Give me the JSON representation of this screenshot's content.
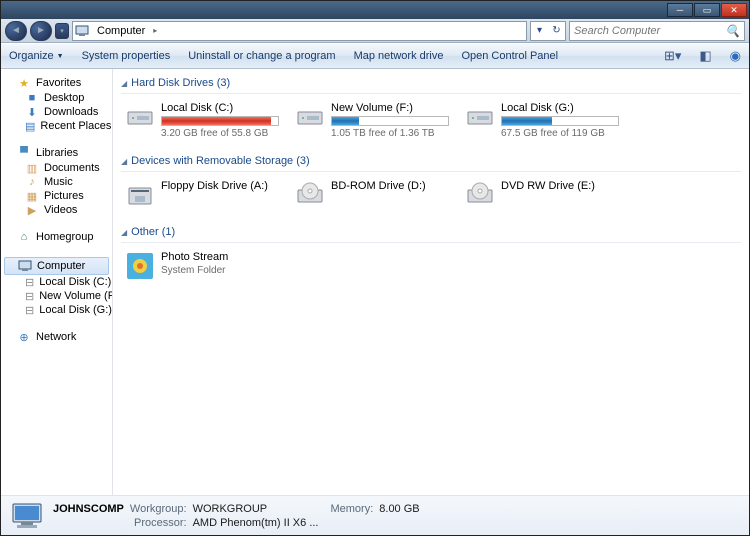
{
  "breadcrumb": {
    "location": "Computer"
  },
  "search": {
    "placeholder": "Search Computer"
  },
  "toolbar": {
    "organize": "Organize",
    "sysprops": "System properties",
    "uninstall": "Uninstall or change a program",
    "mapdrive": "Map network drive",
    "controlpanel": "Open Control Panel"
  },
  "sidebar": {
    "favorites": {
      "label": "Favorites",
      "items": [
        "Desktop",
        "Downloads",
        "Recent Places"
      ]
    },
    "libraries": {
      "label": "Libraries",
      "items": [
        "Documents",
        "Music",
        "Pictures",
        "Videos"
      ]
    },
    "homegroup": {
      "label": "Homegroup"
    },
    "computer": {
      "label": "Computer",
      "items": [
        "Local Disk (C:)",
        "New Volume (F:)",
        "Local Disk (G:)"
      ]
    },
    "network": {
      "label": "Network"
    }
  },
  "sections": {
    "hdd": {
      "title": "Hard Disk Drives (3)"
    },
    "removable": {
      "title": "Devices with Removable Storage (3)"
    },
    "other": {
      "title": "Other (1)"
    }
  },
  "drives": {
    "hdd": [
      {
        "name": "Local Disk (C:)",
        "free": "3.20 GB free of 55.8 GB",
        "pct": 94,
        "color": "red"
      },
      {
        "name": "New Volume (F:)",
        "free": "1.05 TB free of 1.36 TB",
        "pct": 23,
        "color": "blue"
      },
      {
        "name": "Local Disk (G:)",
        "free": "67.5 GB free of 119 GB",
        "pct": 43,
        "color": "blue"
      }
    ],
    "removable": [
      {
        "name": "Floppy Disk Drive (A:)"
      },
      {
        "name": "BD-ROM Drive (D:)"
      },
      {
        "name": "DVD RW Drive (E:)"
      }
    ],
    "other": [
      {
        "name": "Photo Stream",
        "sub": "System Folder"
      }
    ]
  },
  "details": {
    "name": "JOHNSCOMP",
    "workgroup_k": "Workgroup:",
    "workgroup_v": "WORKGROUP",
    "memory_k": "Memory:",
    "memory_v": "8.00 GB",
    "processor_k": "Processor:",
    "processor_v": "AMD Phenom(tm) II X6 ..."
  }
}
